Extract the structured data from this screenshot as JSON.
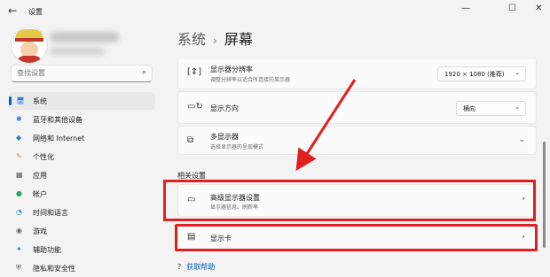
{
  "window": {
    "back_icon": "←",
    "title": "设置",
    "minimize": "—",
    "maximize": "☐",
    "close": "✕"
  },
  "search": {
    "placeholder": "查找设置",
    "icon": "⌕"
  },
  "nav": [
    {
      "label": "系统",
      "icon": "🖥",
      "selected": true
    },
    {
      "label": "蓝牙和其他设备",
      "icon": "✱",
      "selected": false
    },
    {
      "label": "网络和 Internet",
      "icon": "◆",
      "selected": false
    },
    {
      "label": "个性化",
      "icon": "✎",
      "selected": false
    },
    {
      "label": "应用",
      "icon": "▦",
      "selected": false
    },
    {
      "label": "帐户",
      "icon": "●",
      "selected": false
    },
    {
      "label": "时间和语言",
      "icon": "◔",
      "selected": false
    },
    {
      "label": "游戏",
      "icon": "◉",
      "selected": false
    },
    {
      "label": "辅助功能",
      "icon": "✦",
      "selected": false
    },
    {
      "label": "隐私和安全性",
      "icon": "⛨",
      "selected": false
    }
  ],
  "header": {
    "crumb": "系统",
    "separator": "›",
    "current": "屏幕"
  },
  "cards": {
    "resolution": {
      "title": "显示器分辨率",
      "subtitle": "调整分辨率以适合所连接的显示器",
      "value": "1920 × 1080 (推荐)",
      "chevron": "⌄"
    },
    "orientation": {
      "title": "显示方向",
      "value": "横向",
      "chevron": "⌄"
    },
    "multi": {
      "title": "多显示器",
      "subtitle": "选择显示器的呈现模式",
      "chevron": "⌄"
    },
    "advanced": {
      "title": "高级显示器设置",
      "subtitle": "显示器信息、刷新率",
      "chevron": "›"
    },
    "gpu": {
      "title": "显示卡",
      "chevron": "›"
    }
  },
  "section_related": "相关设置",
  "help": {
    "icon": "?",
    "label": "获取帮助"
  },
  "colors": {
    "accent": "#005fb8",
    "annotation": "#e02020"
  }
}
